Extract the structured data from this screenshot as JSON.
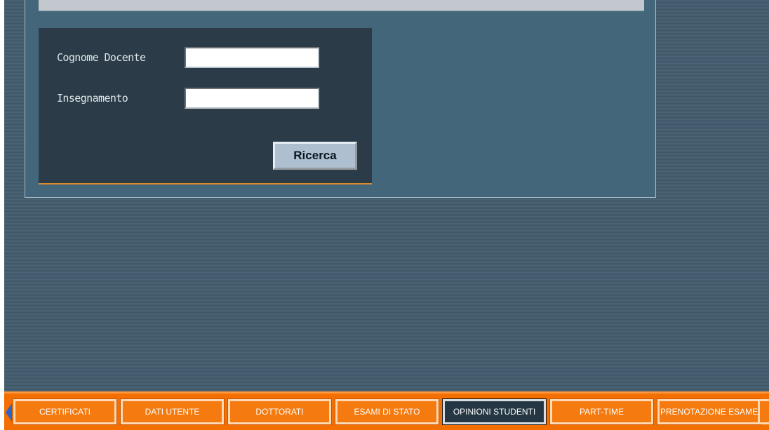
{
  "search_form": {
    "surname_label": "Cognome Docente",
    "surname_value": "",
    "course_label": "Insegnamento",
    "course_value": "",
    "search_button_label": "Ricerca"
  },
  "bottom_nav": {
    "tabs": [
      {
        "label": "CERTIFICATI",
        "active": false
      },
      {
        "label": "DATI UTENTE",
        "active": false
      },
      {
        "label": "DOTTORATI",
        "active": false
      },
      {
        "label": "ESAMI DI STATO",
        "active": false
      },
      {
        "label": "OPINIONI STUDENTI",
        "active": true
      },
      {
        "label": "PART-TIME",
        "active": false
      },
      {
        "label": "PRENOTAZIONE ESAME",
        "active": false
      }
    ],
    "prev_icon": "arrow-left-icon"
  },
  "colors": {
    "background": "#445d6e",
    "form_background": "#2b3c48",
    "nav_orange": "#f26f00",
    "active_tab": "#263744",
    "button": "#aec0d0"
  }
}
